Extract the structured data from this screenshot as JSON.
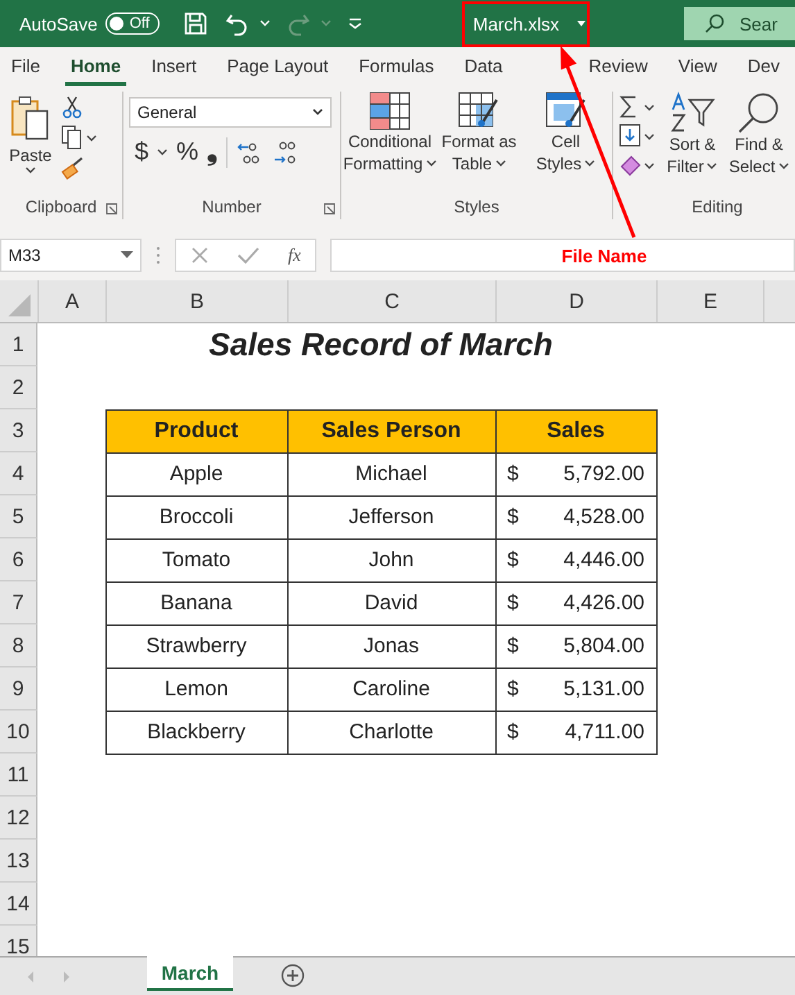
{
  "title_bar": {
    "autosave_label": "AutoSave",
    "autosave_toggle": {
      "on": false,
      "label": "Off"
    },
    "file_name": "March.xlsx",
    "search_placeholder": "Sear"
  },
  "ribbon_tabs": [
    {
      "label": "File",
      "selected": false
    },
    {
      "label": "Home",
      "selected": true
    },
    {
      "label": "Insert",
      "selected": false
    },
    {
      "label": "Page Layout",
      "selected": false
    },
    {
      "label": "Formulas",
      "selected": false
    },
    {
      "label": "Data",
      "selected": false
    },
    {
      "label": "Review",
      "selected": false
    },
    {
      "label": "View",
      "selected": false
    },
    {
      "label": "Dev",
      "selected": false
    }
  ],
  "ribbon": {
    "clipboard": {
      "paste": "Paste",
      "label": "Clipboard"
    },
    "number": {
      "format": "General",
      "currency": "$",
      "percent": "%",
      "comma": "❟",
      "label": "Number"
    },
    "styles": {
      "buttons": [
        [
          "Conditional",
          "Formatting"
        ],
        [
          "Format as",
          "Table"
        ],
        [
          "Cell",
          "Styles"
        ]
      ],
      "label": "Styles"
    },
    "editing": {
      "buttons": [
        [
          "Sort &",
          "Filter"
        ],
        [
          "Find &",
          "Select"
        ]
      ],
      "label": "Editing"
    }
  },
  "formula_bar": {
    "name_box": "M33",
    "fx": "fx"
  },
  "annotation": {
    "label": "File Name"
  },
  "sheet": {
    "columns": [
      "A",
      "B",
      "C",
      "D",
      "E"
    ],
    "rows": [
      "1",
      "2",
      "3",
      "4",
      "5",
      "6",
      "7",
      "8",
      "9",
      "10",
      "11",
      "12",
      "13",
      "14",
      "15"
    ],
    "title": "Sales Record of March",
    "table": {
      "headers": [
        "Product",
        "Sales Person",
        "Sales"
      ],
      "rows": [
        {
          "product": "Apple",
          "person": "Michael",
          "currency": "$",
          "amount": "5,792.00"
        },
        {
          "product": "Broccoli",
          "person": "Jefferson",
          "currency": "$",
          "amount": "4,528.00"
        },
        {
          "product": "Tomato",
          "person": "John",
          "currency": "$",
          "amount": "4,446.00"
        },
        {
          "product": "Banana",
          "person": "David",
          "currency": "$",
          "amount": "4,426.00"
        },
        {
          "product": "Strawberry",
          "person": "Jonas",
          "currency": "$",
          "amount": "5,804.00"
        },
        {
          "product": "Lemon",
          "person": "Caroline",
          "currency": "$",
          "amount": "5,131.00"
        },
        {
          "product": "Blackberry",
          "person": "Charlotte",
          "currency": "$",
          "amount": "4,711.00"
        }
      ]
    }
  },
  "sheet_tabs": [
    {
      "label": "March",
      "selected": true
    }
  ]
}
